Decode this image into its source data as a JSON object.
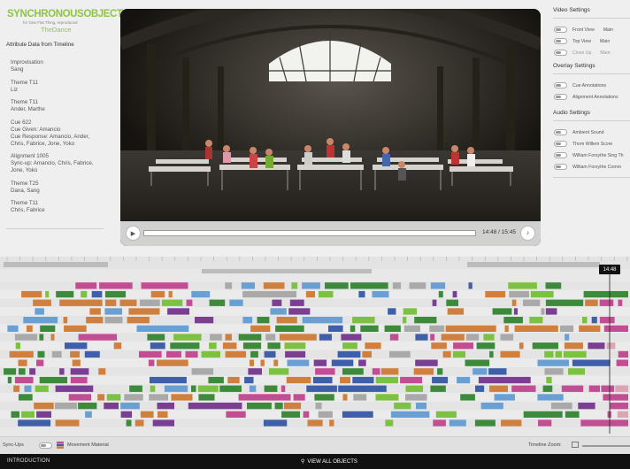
{
  "logo": {
    "title": "SYNCHRONOUSOBJECTS",
    "subtitle": "for One Flat Thing, reproduced",
    "dance": "TheDance"
  },
  "attributes": {
    "title": "Attribute Data from Timeline",
    "items": [
      {
        "lines": [
          "Improvisation",
          "Sang"
        ]
      },
      {
        "lines": [
          "Theme T11",
          "Liz"
        ]
      },
      {
        "lines": [
          "Theme T11",
          "Ander, Marthe"
        ]
      },
      {
        "lines": [
          "Cue 622",
          "Cue Given: Amancio",
          "Cue Response: Amancio, Ander,",
          "Chris, Fabrice, Jone, Yoko"
        ]
      },
      {
        "lines": [
          "Alignment 1005",
          "Sync-up: Amancio, Chris, Fabrice,",
          "Jone, Yoko"
        ]
      },
      {
        "lines": [
          "Theme T25",
          "Dana, Sang"
        ]
      },
      {
        "lines": [
          "Theme T11",
          "Chris, Fabrice"
        ]
      }
    ]
  },
  "video": {
    "time": "14:48 / 15:45",
    "play_icon": "play-icon",
    "volume_icon": "volume-icon"
  },
  "settings": {
    "video_title": "Video Settings",
    "video_rows": [
      {
        "label": "Front View",
        "extra": "Main",
        "dim": false
      },
      {
        "label": "Top View",
        "extra": "Main",
        "dim": false
      },
      {
        "label": "Close Up",
        "extra": "Main",
        "dim": true
      }
    ],
    "overlay_title": "Overlay Settings",
    "overlay_rows": [
      {
        "label": "Cue Annotations"
      },
      {
        "label": "Alignment Annotations"
      }
    ],
    "audio_title": "Audio Settings",
    "audio_rows": [
      {
        "label": "Ambient Sound"
      },
      {
        "label": "Thom Willem Score"
      },
      {
        "label": "William Forsythe Sing Th"
      },
      {
        "label": "William Forsythe Comm"
      }
    ]
  },
  "timeline": {
    "playhead_time": "14:48",
    "syncups_label": "Sync-Ups",
    "movement_label": "Movement Material",
    "zoom_label": "Timeline Zoom:",
    "colors": {
      "green": "#3e8a3c",
      "purple": "#7a3f93",
      "orange": "#cf7f3e",
      "blue": "#3f5fa8",
      "lightblue": "#6a9fd3",
      "gray": "#a9a9a9",
      "lightgreen": "#7dc142",
      "pink": "#c34d93",
      "lightpink": "#d9a6b3"
    }
  },
  "footer": {
    "intro": "INTRODUCTION",
    "view_all": "VIEW ALL OBJECTS",
    "view_all_icon": "search-icon"
  }
}
